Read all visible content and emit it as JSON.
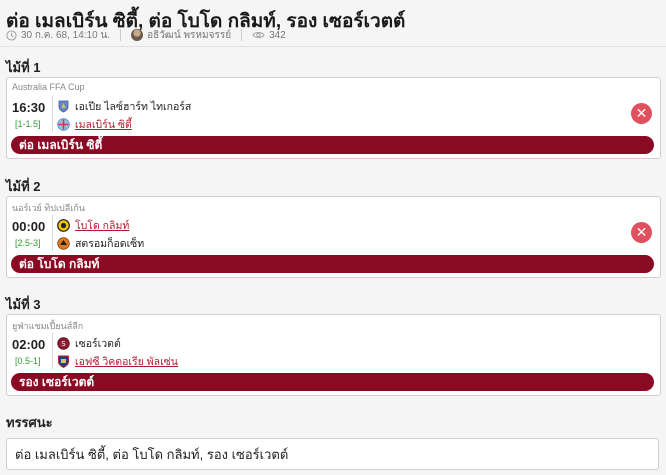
{
  "article": {
    "title": "ต่อ เมลเบิร์น ซิตี้, ต่อ โบโด กลิมท์, รอง เซอร์เวตต์",
    "date": "30 ก.ค. 68, 14:10 น.",
    "author": "อธิวัฒน์ พรหมจรรย์",
    "views": "342"
  },
  "picks": [
    {
      "label": "ไม้ที่ 1",
      "league": "Australia FFA Cup",
      "time": "16:30",
      "handicap": "[1-1.5]",
      "home": "เอเปีย ไลซ์ฮาร์ท ไทเกอร์ส",
      "away": "เมลเบิร์น ซิตี้",
      "picked": "away",
      "result_icon": "close-icon",
      "result_color": "#e0505e",
      "pick_text": "ต่อ เมลเบิร์น ซิตี้"
    },
    {
      "label": "ไม้ที่ 2",
      "league": "นอร์เวย์ ทิปเปลีเก้น",
      "time": "00:00",
      "handicap": "[2.5-3]",
      "home": "โบโด กลิมท์",
      "away": "สตรอมก็อดเซ็ท",
      "picked": "home",
      "result_icon": "close-icon",
      "result_color": "#e0505e",
      "pick_text": "ต่อ โบโด กลิมท์"
    },
    {
      "label": "ไม้ที่ 3",
      "league": "ยูฟ่าแชมเปี้ยนส์ลีก",
      "time": "02:00",
      "handicap": "[0.5-1]",
      "home": "เซอร์เวตต์",
      "away": "เอฟซี วิคตอเรีย พัลเซ่น",
      "picked": "away",
      "pick_text": "รอง เซอร์เวตต์"
    }
  ],
  "summary": {
    "label": "ทรรศนะ",
    "text": "ต่อ เมลเบิร์น ซิตี้, ต่อ โบโด กลิมท์, รอง เซอร์เวตต์"
  },
  "colors": {
    "pick_bar": "#8a0a24",
    "handicap": "#2e9e2e",
    "picked_team": "#b01c2e",
    "lose_badge": "#e0505e"
  }
}
